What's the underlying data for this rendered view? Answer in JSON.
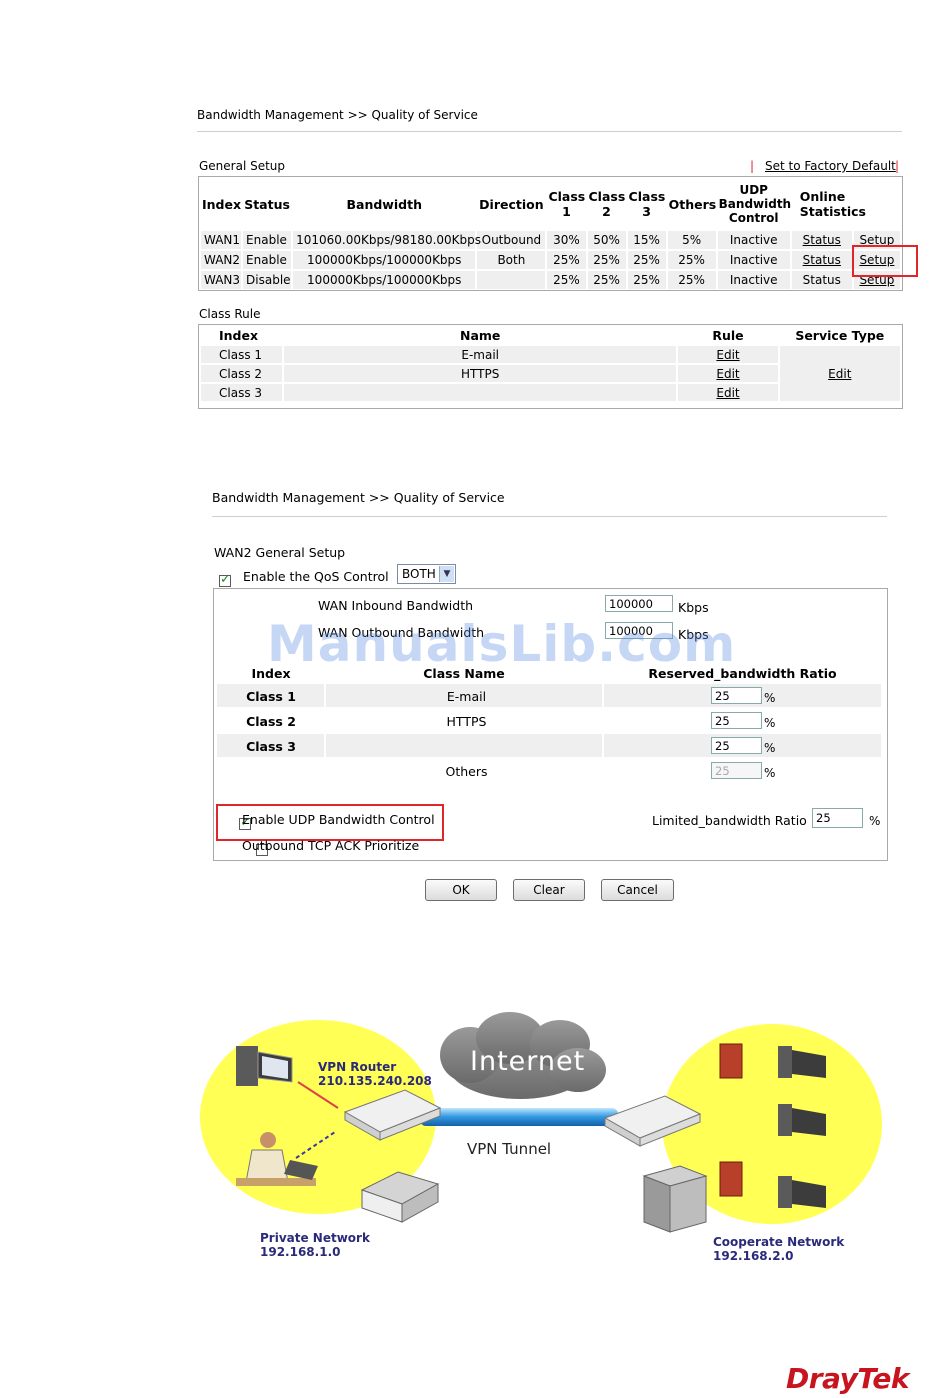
{
  "panel1": {
    "breadcrumb": "Bandwidth Management >> Quality of Service",
    "general_setup_title": "General Setup",
    "factory_sep_left": "|",
    "factory_default_link": "Set to Factory Default",
    "factory_sep_right": "|",
    "headers": {
      "index": "Index",
      "status": "Status",
      "bandwidth": "Bandwidth",
      "direction": "Direction",
      "class1": "Class 1",
      "class2": "Class 2",
      "class3": "Class 3",
      "others": "Others",
      "udp": "UDP Bandwidth Control",
      "online": "Online Statistics"
    },
    "rows": [
      {
        "index": "WAN1",
        "status": "Enable",
        "bandwidth": "101060.00Kbps/98180.00Kbps",
        "direction": "Outbound",
        "c1": "30%",
        "c2": "50%",
        "c3": "15%",
        "others": "5%",
        "udp": "Inactive",
        "stat": "Status",
        "setup": "Setup"
      },
      {
        "index": "WAN2",
        "status": "Enable",
        "bandwidth": "100000Kbps/100000Kbps",
        "direction": "Both",
        "c1": "25%",
        "c2": "25%",
        "c3": "25%",
        "others": "25%",
        "udp": "Inactive",
        "stat": "Status",
        "setup": "Setup"
      },
      {
        "index": "WAN3",
        "status": "Disable",
        "bandwidth": "100000Kbps/100000Kbps",
        "direction": "",
        "c1": "25%",
        "c2": "25%",
        "c3": "25%",
        "others": "25%",
        "udp": "Inactive",
        "stat": "Status",
        "setup": "Setup"
      }
    ],
    "class_rule_title": "Class Rule",
    "class_headers": {
      "index": "Index",
      "name": "Name",
      "rule": "Rule",
      "service_type": "Service Type"
    },
    "class_rows": [
      {
        "index": "Class 1",
        "name": "E-mail",
        "rule": "Edit"
      },
      {
        "index": "Class 2",
        "name": "HTTPS",
        "rule": "Edit"
      },
      {
        "index": "Class 3",
        "name": "",
        "rule": "Edit"
      }
    ],
    "service_type_edit": "Edit"
  },
  "panel2": {
    "breadcrumb": "Bandwidth Management >> Quality of Service",
    "title": "WAN2 General Setup",
    "enable_qos_label": "Enable the QoS Control",
    "enable_qos_checked": true,
    "direction_value": "BOTH",
    "inbound_label": "WAN Inbound Bandwidth",
    "inbound_value": "100000",
    "inbound_unit": "Kbps",
    "outbound_label": "WAN Outbound Bandwidth",
    "outbound_value": "100000",
    "outbound_unit": "Kbps",
    "col_index": "Index",
    "col_class_name": "Class Name",
    "col_ratio": "Reserved_bandwidth Ratio",
    "classes": [
      {
        "index": "Class 1",
        "name": "E-mail",
        "ratio": "25",
        "unit": "%"
      },
      {
        "index": "Class 2",
        "name": "HTTPS",
        "ratio": "25",
        "unit": "%"
      },
      {
        "index": "Class 3",
        "name": "",
        "ratio": "25",
        "unit": "%"
      }
    ],
    "others_label": "Others",
    "others_ratio": "25",
    "others_unit": "%",
    "udp_label": "Enable UDP Bandwidth Control",
    "udp_checked": true,
    "tcp_ack_label": "Outbound TCP ACK Prioritize",
    "tcp_ack_checked": false,
    "limited_label": "Limited_bandwidth Ratio",
    "limited_value": "25",
    "limited_unit": "%",
    "ok": "OK",
    "clear": "Clear",
    "cancel": "Cancel"
  },
  "watermark": "ManualsLib.com",
  "diagram": {
    "internet": "Internet",
    "vpn_router": "VPN Router",
    "vpn_router_ip": "210.135.240.208",
    "vpn_tunnel": "VPN Tunnel",
    "private_network": "Private Network",
    "private_ip": "192.168.1.0",
    "cooperate_network": "Cooperate Network",
    "cooperate_ip": "192.168.2.0"
  },
  "brand": "DrayTek",
  "colors": {
    "highlight": "#e0262b",
    "brand": "#c8141e",
    "bubble": "#ffff55",
    "tunnel": "#2f97e0",
    "label": "#2a2a7a"
  }
}
